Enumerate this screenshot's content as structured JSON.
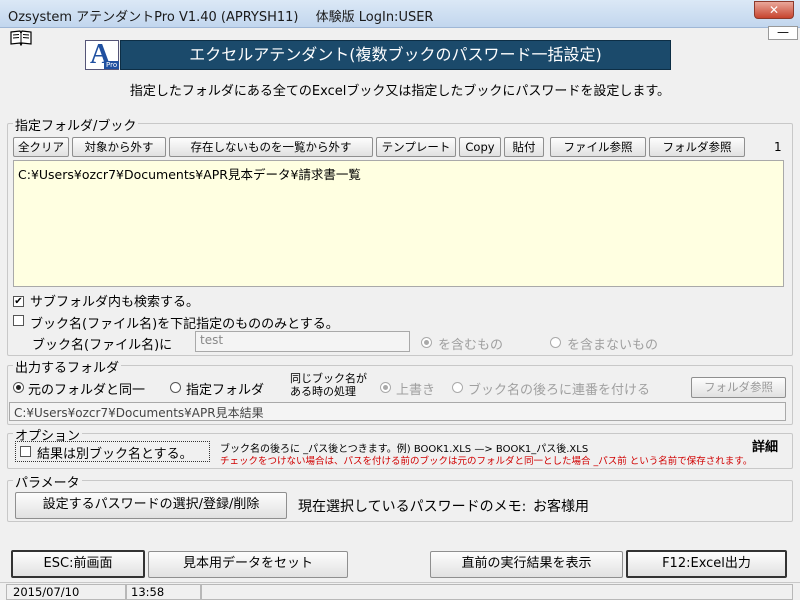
{
  "window": {
    "title": "Ozsystem アテンダントPro V1.40 (APRYSH11)　 体験版 LogIn:USER",
    "close_glyph": "✕",
    "min_glyph": "—"
  },
  "header": {
    "logo_letter": "A",
    "logo_sub": "Pro",
    "banner": "エクセルアテンダント(複数ブックのパスワード一括設定)",
    "description": "指定したフォルダにある全てのExcelブック又は指定したブックにパスワードを設定します。"
  },
  "folder_group": {
    "label": "指定フォルダ/ブック",
    "buttons": {
      "clear_all": "全クリア",
      "exclude_target": "対象から外す",
      "exclude_missing": "存在しないものを一覧から外す",
      "template": "テンプレート",
      "copy": "Copy",
      "paste": "貼付",
      "file_browse": "ファイル参照",
      "folder_browse": "フォルダ参照"
    },
    "count": "1",
    "paths": "C:¥Users¥ozcr7¥Documents¥APR見本データ¥請求書一覧",
    "subfolder_check": "サブフォルダ内も検索する。",
    "subfolder_checked": true,
    "bookname_check": "ブック名(ファイル名)を下記指定のもののみとする。",
    "bookname_checked": false,
    "bookname_label": "ブック名(ファイル名)に",
    "bookname_value": "test",
    "contains_label": "を含むもの",
    "not_contains_label": "を含まないもの"
  },
  "output_group": {
    "label": "出力するフォルダ",
    "same_folder": "元のフォルダと同一",
    "specified_folder": "指定フォルダ",
    "same_name_line1": "同じブック名が",
    "same_name_line2": "ある時の処理",
    "overwrite": "上書き",
    "serial_suffix": "ブック名の後ろに連番を付ける",
    "folder_browse": "フォルダ参照",
    "output_path": "C:¥Users¥ozcr7¥Documents¥APR見本結果"
  },
  "options_group": {
    "label": "オプション",
    "separate_name_check": "結果は別ブック名とする。",
    "separate_name_checked": false,
    "note1": "ブック名の後ろに _パス後とつきます。例) BOOK1.XLS —> BOOK1_パス後.XLS",
    "note2": "チェックをつけない場合は、パスを付ける前のブックは元のフォルダと同一とした場合 _パス前 という名前で保存されます。",
    "detail": "詳細"
  },
  "params_group": {
    "label": "パラメータ",
    "select_password": "設定するパスワードの選択/登録/削除",
    "memo_label": "現在選択しているパスワードのメモ:",
    "memo_value": "お客様用"
  },
  "footer": {
    "esc": "ESC:前画面",
    "sample_data": "見本用データをセット",
    "show_last": "直前の実行結果を表示",
    "f12": "F12:Excel出力"
  },
  "status": {
    "date": "2015/07/10",
    "time": "13:58"
  },
  "colors": {
    "banner_bg": "#1b4a6b",
    "input_yellow": "#ffffe1",
    "note_red": "#d00000"
  }
}
